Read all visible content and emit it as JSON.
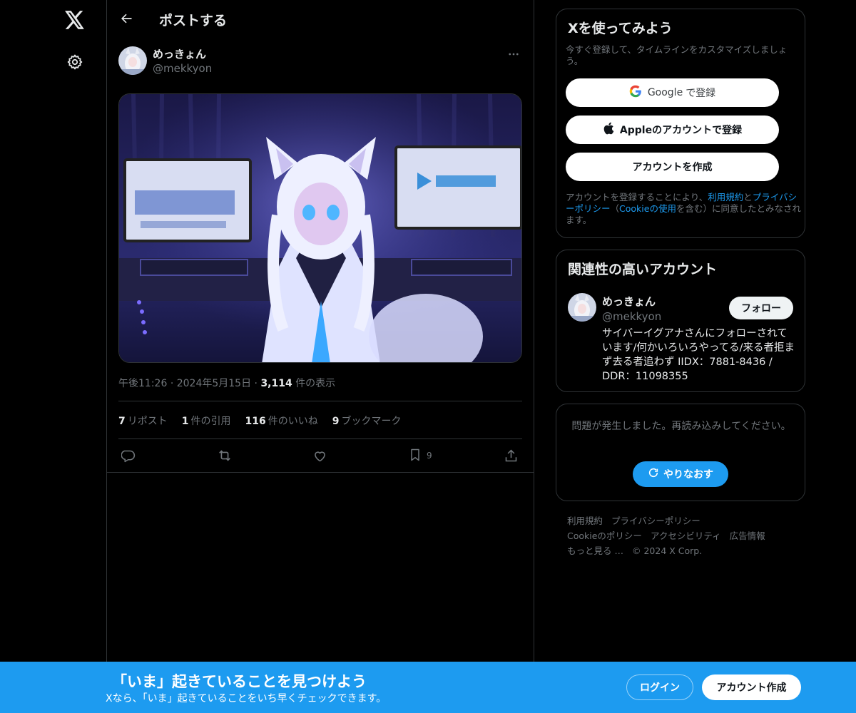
{
  "nav": {
    "logo_icon": "x-logo-icon",
    "settings_icon": "gear-icon"
  },
  "header": {
    "title": "ポストする"
  },
  "post": {
    "author_name": "めっきょん",
    "author_handle": "@mekkyon",
    "media_alt": "",
    "time": "午後11:26",
    "date": "2024年5月15日",
    "views_count": "3,114",
    "views_label": "件の表示",
    "stats": {
      "reposts_count": "7",
      "reposts_label": "リポスト",
      "quotes_count": "1",
      "quotes_label": "件の引用",
      "likes_count": "116",
      "likes_label": "件のいいね",
      "bookmarks_count": "9",
      "bookmarks_label": "ブックマーク"
    },
    "bookmark_action_count": "9"
  },
  "signup": {
    "title": "Xを使ってみよう",
    "subtitle": "今すぐ登録して、タイムラインをカスタマイズしましょう。",
    "google_brand": "Google",
    "google_suffix": "で登録",
    "apple_label": "Appleのアカウントで登録",
    "create_label": "アカウントを作成",
    "legal_prefix": "アカウントを登録することにより、",
    "legal_terms": "利用規約",
    "legal_and": "と",
    "legal_privacy": "プライバシーポリシー",
    "legal_paren_open": "（",
    "legal_cookie": "Cookieの使用",
    "legal_suffix": "を含む）に同意したとみなされます。"
  },
  "related": {
    "title": "関連性の高いアカウント",
    "name": "めっきょん",
    "handle": "@mekkyon",
    "follow_label": "フォロー",
    "bio": "サイバーイグアナさんにフォローされています/何かいろいろやってる/来る者拒まず去る者追わず IIDX：7881-8436 / DDR：11098355"
  },
  "error": {
    "message": "問題が発生しました。再読み込みしてください。",
    "retry_label": "やりなおす"
  },
  "footer": {
    "links": [
      "利用規約",
      "プライバシーポリシー",
      "Cookieのポリシー",
      "アクセシビリティ",
      "広告情報",
      "もっと見る …"
    ],
    "copyright": "© 2024 X Corp."
  },
  "banner": {
    "title": "「いま」起きていることを見つけよう",
    "subtitle": "Xなら、「いま」起きていることをいち早くチェックできます。",
    "login_label": "ログイン",
    "signup_label": "アカウント作成"
  },
  "colors": {
    "accent": "#1d9bf0",
    "border": "#2f3336",
    "muted": "#71767b",
    "text": "#e7e9ea",
    "background": "#000000"
  }
}
